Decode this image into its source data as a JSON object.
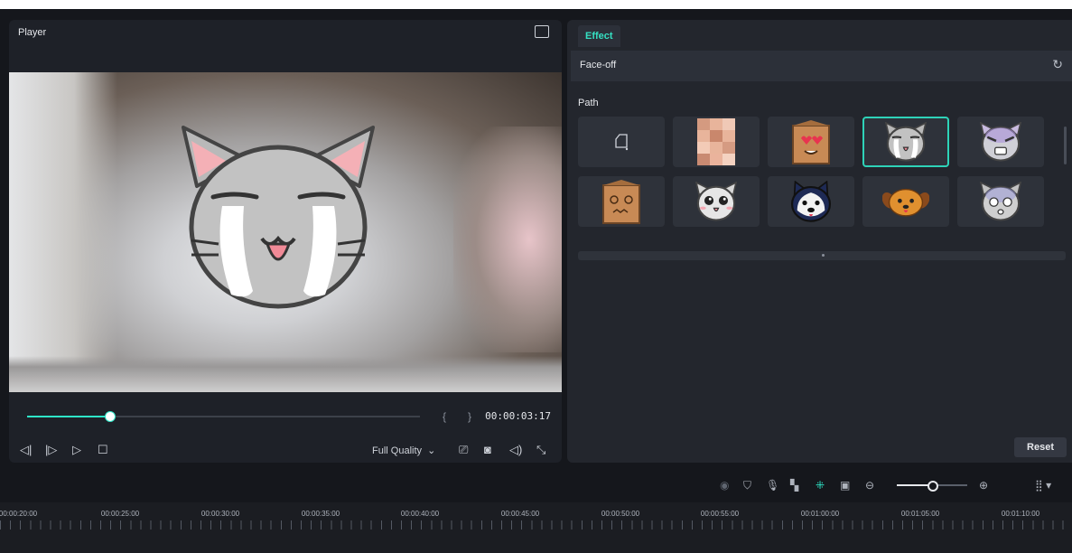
{
  "player": {
    "title": "Player",
    "progress": 0.21,
    "timecode": "00:00:03:17",
    "quality": "Full Quality"
  },
  "effect": {
    "tab": "Effect",
    "section_title": "Face-off",
    "path_label": "Path",
    "reset_label": "Reset",
    "selected_index": 3,
    "items": [
      "none",
      "mosaic",
      "box-heart-eyes",
      "cat-crying",
      "cat-angry",
      "box-dizzy",
      "cat-surprised",
      "husky",
      "dog",
      "cat-shocked"
    ]
  },
  "timeline": {
    "zoom_level": 0.5,
    "ticks": [
      "00:00:20:00",
      "00:00:25:00",
      "00:00:30:00",
      "00:00:35:00",
      "00:00:40:00",
      "00:00:45:00",
      "00:00:50:00",
      "00:00:55:00",
      "00:01:00:00",
      "00:01:05:00",
      "00:01:10:00"
    ]
  },
  "colors": {
    "accent": "#2ee6c8",
    "background": "#15171c",
    "panel": "#23262d"
  }
}
